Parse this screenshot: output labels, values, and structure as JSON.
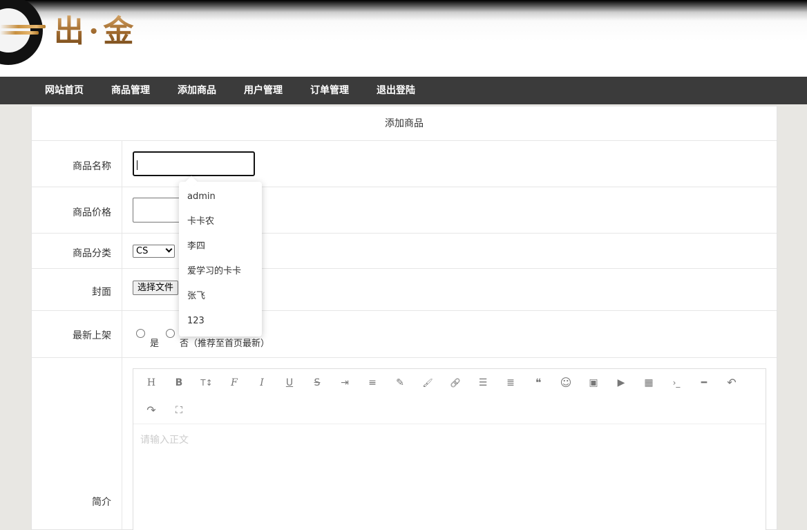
{
  "logo": {
    "text": "出·金"
  },
  "nav": {
    "items": [
      "网站首页",
      "商品管理",
      "添加商品",
      "用户管理",
      "订单管理",
      "退出登陆"
    ]
  },
  "form": {
    "title": "添加商品",
    "name_label": "商品名称",
    "name_value": "",
    "price_label": "商品价格",
    "price_value": "",
    "category_label": "商品分类",
    "category_selected": "CS",
    "cover_label": "封面",
    "file_button": "选择文件",
    "newest_label": "最新上架",
    "radio_yes": "是",
    "radio_no": "否（推荐至首页最新）",
    "intro_label": "简介",
    "editor_placeholder": "请输入正文"
  },
  "editor_toolbar": {
    "icons": [
      "heading-icon",
      "bold-icon",
      "font-size-icon",
      "font-family-icon",
      "italic-icon",
      "underline-icon",
      "strikethrough-icon",
      "indent-icon",
      "line-height-icon",
      "font-color-icon",
      "background-color-icon",
      "link-icon",
      "list-icon",
      "align-icon",
      "quote-icon",
      "emoticon-icon",
      "image-icon",
      "video-icon",
      "table-icon",
      "code-icon",
      "divider-icon",
      "undo-icon",
      "redo-icon",
      "fullscreen-icon"
    ],
    "glyphs": [
      "H",
      "B",
      "T↕",
      "F",
      "I",
      "U",
      "S",
      "⇥",
      "≡",
      "✎",
      "🖌",
      "🔗",
      "☰",
      "≣",
      "❝",
      "☺",
      "▣",
      "▶",
      "▦",
      "›_",
      "━",
      "↶",
      "↷",
      "⛶"
    ]
  },
  "autocomplete": {
    "items": [
      "admin",
      "卡卡农",
      "李四",
      "爱学习的卡卡",
      "张飞",
      "123"
    ]
  }
}
